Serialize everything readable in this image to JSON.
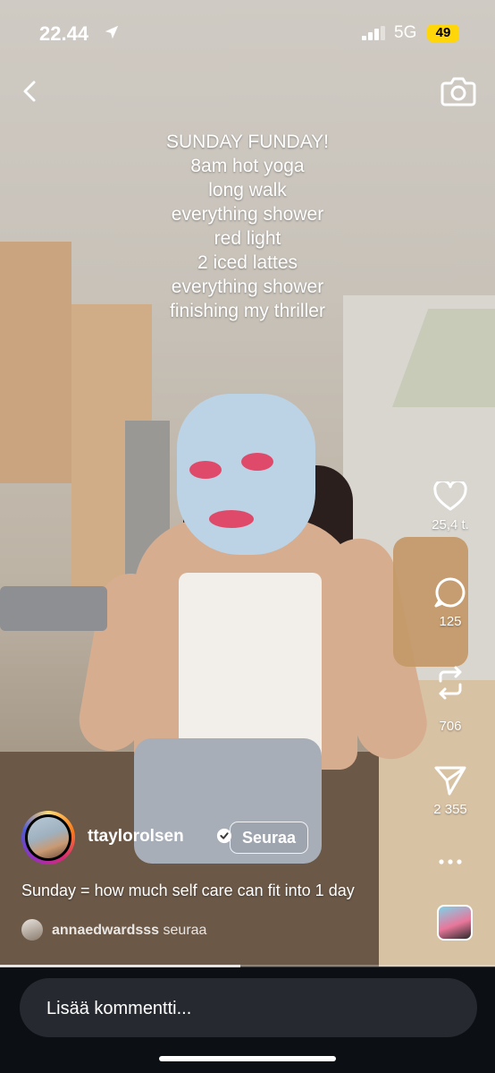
{
  "status_bar": {
    "time": "22.44",
    "network": "5G",
    "battery": "49"
  },
  "overlay_lines": [
    "SUNDAY FUNDAY!",
    "8am hot yoga",
    "long walk",
    "everything shower",
    "red light",
    "2 iced lattes",
    "everything shower",
    "finishing my thriller"
  ],
  "actions": {
    "likes": "25,4 t.",
    "comments": "125",
    "reposts": "706",
    "shares": "2 355"
  },
  "author": {
    "username": "ttaylorolsen",
    "follow_label": "Seuraa"
  },
  "caption": "Sunday = how much self care can fit into 1 day",
  "follower": {
    "name": "annaedwardsss",
    "action": "seuraa"
  },
  "comment": {
    "placeholder": "Lisää kommentti..."
  },
  "playback": {
    "progress": 0.485
  },
  "icons": [
    "location-arrow-icon",
    "signal-icon",
    "back-icon",
    "camera-icon",
    "heart-icon",
    "comment-icon",
    "repost-icon",
    "share-icon",
    "more-icon",
    "verified-icon"
  ]
}
